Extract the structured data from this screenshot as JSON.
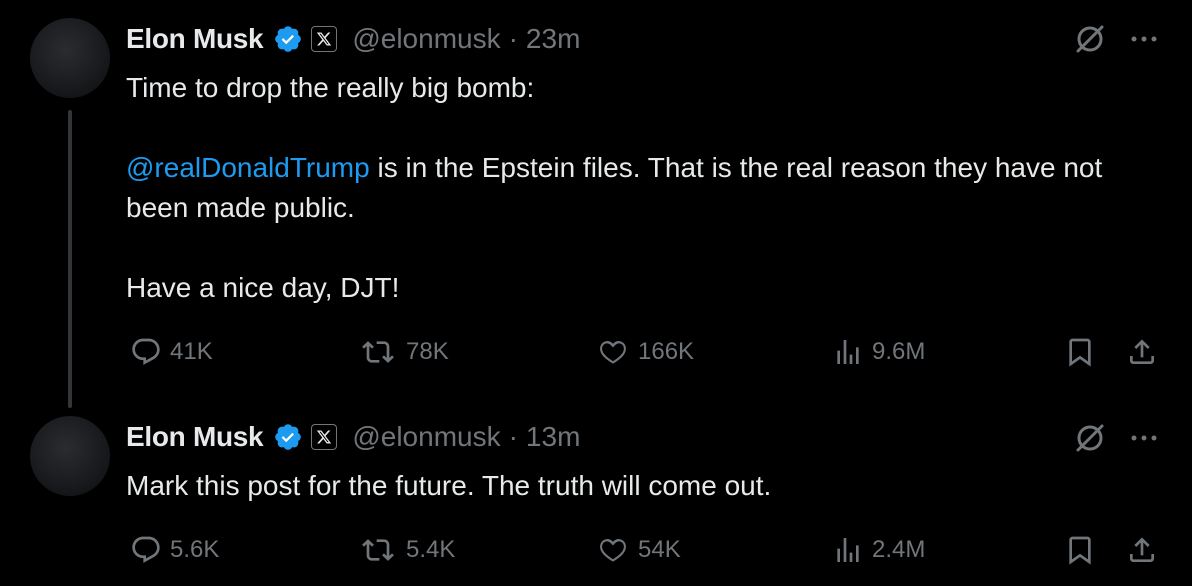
{
  "tweets": [
    {
      "author": "Elon Musk",
      "handle": "@elonmusk",
      "separator": "·",
      "time": "23m",
      "text": {
        "line1": "Time to drop the really big bomb:",
        "mention": "@realDonaldTrump",
        "line2_rest": " is in the Epstein files. That is the real reason they have not been made public.",
        "line3": "Have a nice day, DJT!"
      },
      "replies": "41K",
      "reposts": "78K",
      "likes": "166K",
      "views": "9.6M"
    },
    {
      "author": "Elon Musk",
      "handle": "@elonmusk",
      "separator": "·",
      "time": "13m",
      "text": {
        "line1": "Mark this post for the future. The truth will come out."
      },
      "replies": "5.6K",
      "reposts": "5.4K",
      "likes": "54K",
      "views": "2.4M"
    }
  ],
  "colors": {
    "background": "#000000",
    "text": "#e7e9ea",
    "secondary": "#71767b",
    "link": "#1d9bf0",
    "verified": "#1d9bf0"
  },
  "icons": [
    "verified-icon",
    "x-affiliate-icon",
    "grok-icon",
    "more-icon",
    "reply-icon",
    "repost-icon",
    "like-icon",
    "views-icon",
    "bookmark-icon",
    "share-icon"
  ]
}
